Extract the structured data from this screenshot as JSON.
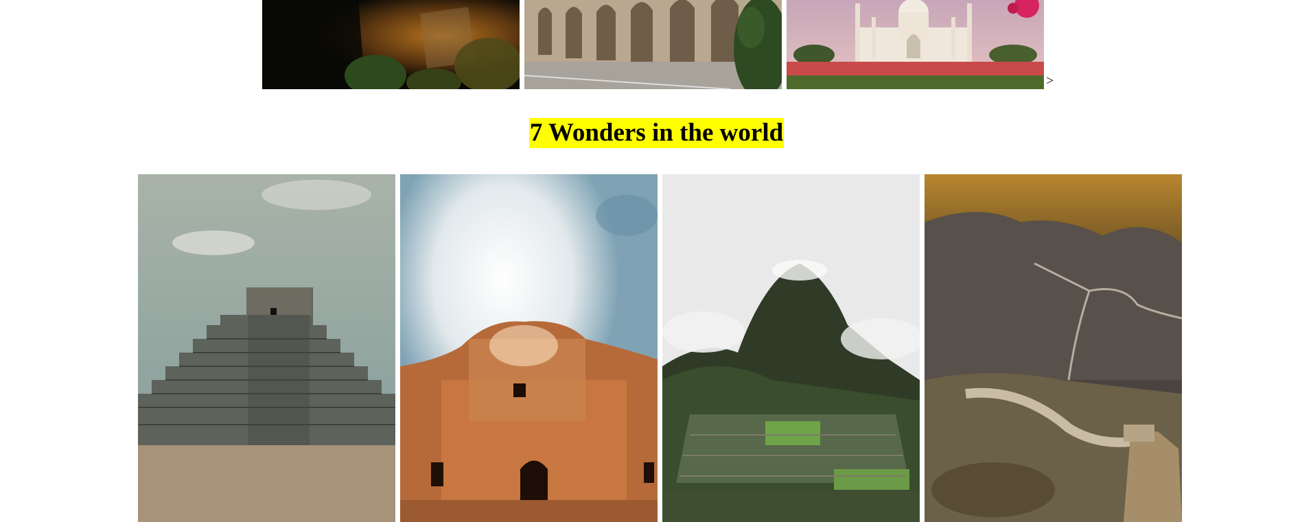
{
  "carousel": {
    "next_label": ">",
    "images": [
      {
        "alt": "Petra at night",
        "icon": "night-canyon-photo"
      },
      {
        "alt": "Colosseum",
        "icon": "colosseum-photo"
      },
      {
        "alt": "Taj Mahal",
        "icon": "taj-mahal-photo"
      }
    ]
  },
  "title": "7 Wonders in the world",
  "gallery": {
    "images": [
      {
        "alt": "Chichen Itza",
        "icon": "pyramid-photo"
      },
      {
        "alt": "Petra",
        "icon": "petra-photo"
      },
      {
        "alt": "Machu Picchu",
        "icon": "machu-picchu-photo"
      },
      {
        "alt": "Great Wall of China",
        "icon": "great-wall-photo"
      }
    ]
  },
  "colors": {
    "title_highlight": "#ffff00",
    "background": "#ffffff"
  }
}
